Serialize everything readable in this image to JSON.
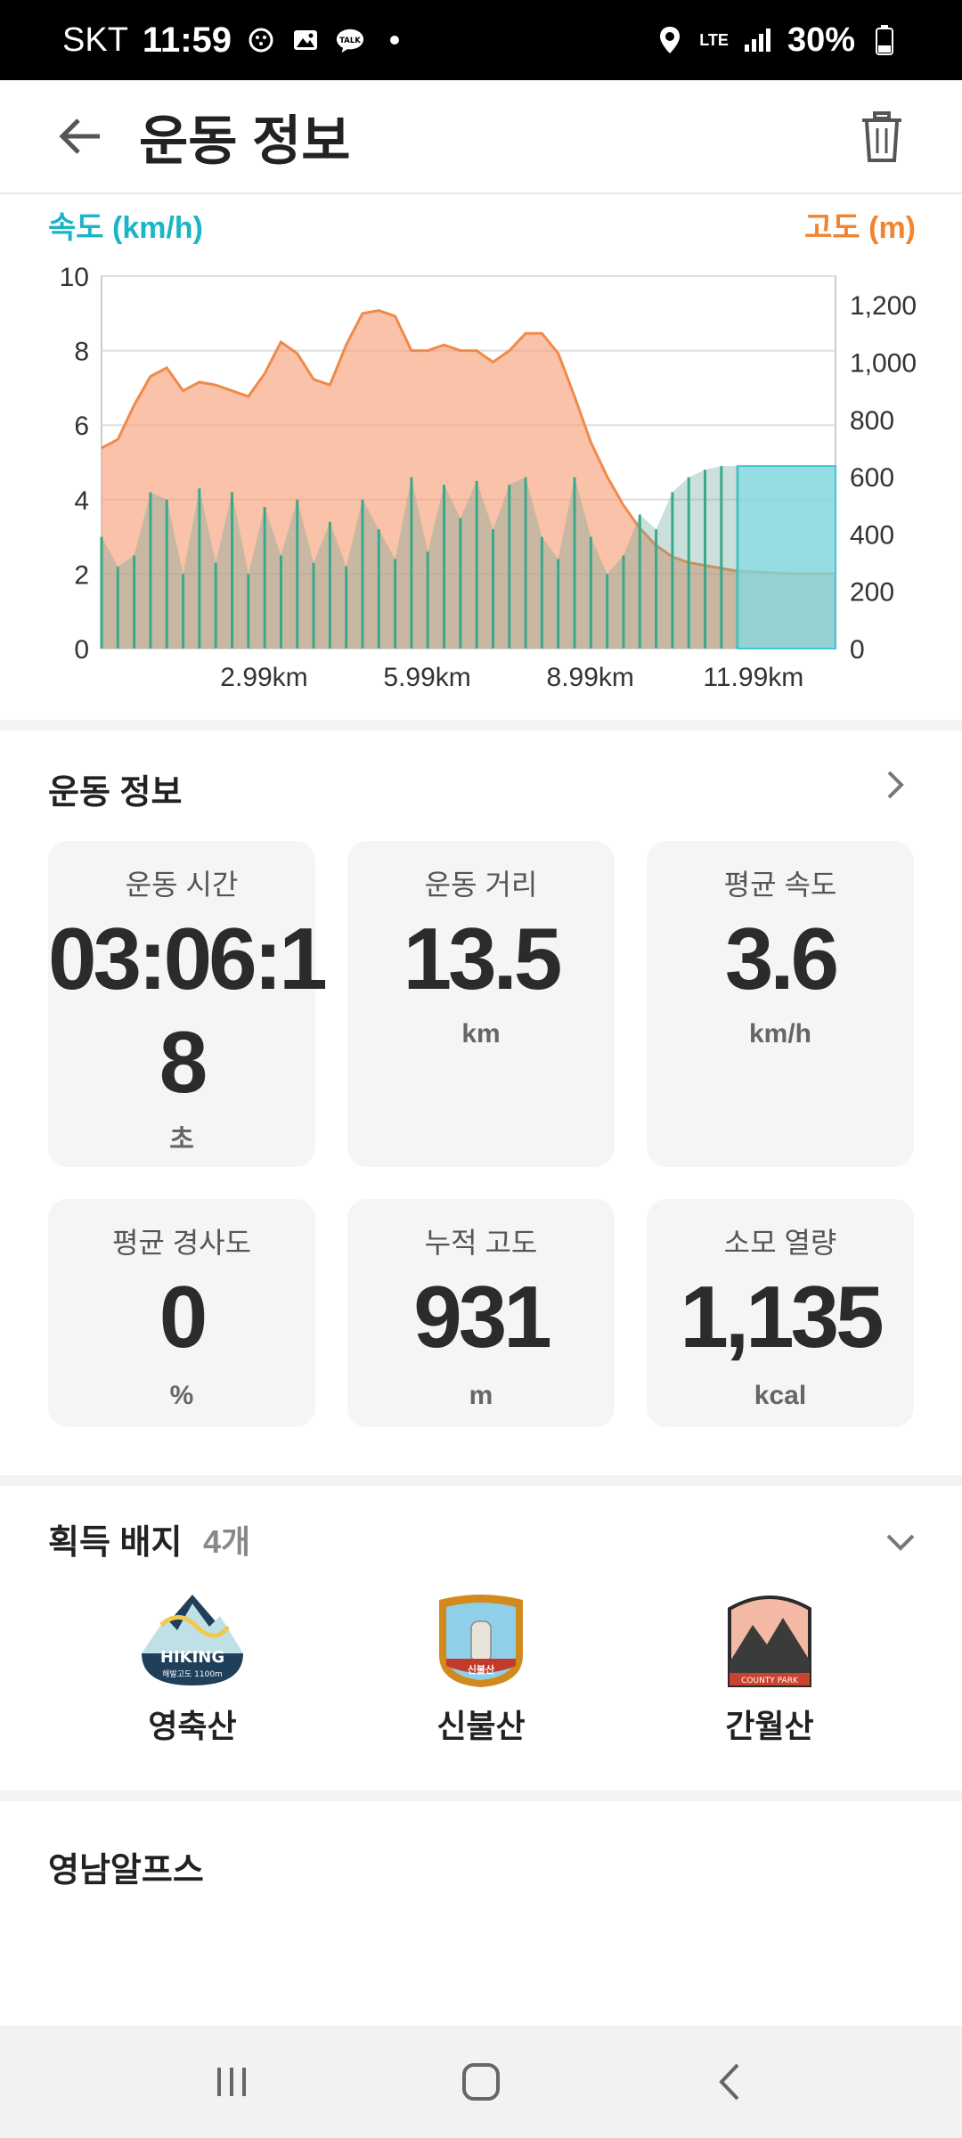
{
  "status": {
    "carrier": "SKT",
    "time": "11:59",
    "network": "LTE",
    "battery": "30%"
  },
  "header": {
    "title": "운동 정보"
  },
  "chart": {
    "left_axis_title": "속도 (km/h)",
    "right_axis_title": "고도 (m)"
  },
  "chart_data": {
    "type": "area",
    "xlabel": "",
    "x_ticks": [
      "2.99km",
      "5.99km",
      "8.99km",
      "11.99km"
    ],
    "left_ylabel": "속도 (km/h)",
    "left_ylim": [
      0,
      10
    ],
    "left_ticks": [
      "0",
      "2",
      "4",
      "6",
      "8",
      "10"
    ],
    "right_ylabel": "고도 (m)",
    "right_ylim": [
      0,
      1300
    ],
    "right_ticks": [
      "0",
      "200",
      "400",
      "600",
      "800",
      "1,000",
      "1,200"
    ],
    "grid": true,
    "series": [
      {
        "axis": "right",
        "color": "#f7a27a",
        "x": [
          0,
          0.3,
          0.6,
          0.9,
          1.2,
          1.5,
          1.8,
          2.1,
          2.4,
          2.7,
          3.0,
          3.3,
          3.6,
          3.9,
          4.2,
          4.5,
          4.8,
          5.1,
          5.4,
          5.7,
          6.0,
          6.3,
          6.6,
          6.9,
          7.2,
          7.5,
          7.8,
          8.1,
          8.4,
          8.7,
          9.0,
          9.3,
          9.6,
          9.9,
          10.2,
          10.5,
          10.8,
          11.1,
          11.4,
          11.7,
          12.0,
          12.3,
          12.6,
          12.9,
          13.2,
          13.5
        ],
        "y": [
          700,
          730,
          850,
          950,
          980,
          900,
          930,
          920,
          900,
          880,
          960,
          1070,
          1030,
          940,
          920,
          1060,
          1170,
          1180,
          1160,
          1040,
          1040,
          1060,
          1040,
          1040,
          1000,
          1040,
          1100,
          1100,
          1030,
          880,
          720,
          600,
          500,
          420,
          360,
          320,
          300,
          290,
          280,
          270,
          268,
          265,
          262,
          262,
          262,
          262
        ]
      },
      {
        "axis": "left",
        "color": "#3aa88a",
        "x": [
          0,
          0.3,
          0.6,
          0.9,
          1.2,
          1.5,
          1.8,
          2.1,
          2.4,
          2.7,
          3.0,
          3.3,
          3.6,
          3.9,
          4.2,
          4.5,
          4.8,
          5.1,
          5.4,
          5.7,
          6.0,
          6.3,
          6.6,
          6.9,
          7.2,
          7.5,
          7.8,
          8.1,
          8.4,
          8.7,
          9.0,
          9.3,
          9.6,
          9.9,
          10.2,
          10.5,
          10.8,
          11.1,
          11.4,
          11.7,
          12.0,
          12.3,
          12.6,
          12.9,
          13.2,
          13.5
        ],
        "y": [
          3.0,
          2.2,
          2.5,
          4.2,
          4.0,
          2.0,
          4.3,
          2.3,
          4.2,
          2.0,
          3.8,
          2.5,
          4.0,
          2.3,
          3.4,
          2.2,
          4.0,
          3.2,
          2.4,
          4.6,
          2.6,
          4.4,
          3.5,
          4.5,
          3.2,
          4.4,
          4.6,
          3.0,
          2.4,
          4.6,
          3.0,
          2.0,
          2.5,
          3.6,
          3.2,
          4.2,
          4.6,
          4.8,
          4.9,
          4.9,
          4.9,
          4.9,
          4.9,
          4.9,
          4.9,
          4.9
        ]
      }
    ]
  },
  "summary": {
    "section_title": "운동 정보",
    "cards": [
      {
        "label": "운동 시간",
        "value_line1": "03:06:1",
        "value_line2": "8",
        "unit": "초"
      },
      {
        "label": "운동 거리",
        "value": "13.5",
        "unit": "km"
      },
      {
        "label": "평균 속도",
        "value": "3.6",
        "unit": "km/h"
      },
      {
        "label": "평균 경사도",
        "value": "0",
        "unit": "%"
      },
      {
        "label": "누적 고도",
        "value": "931",
        "unit": "m"
      },
      {
        "label": "소모 열량",
        "value": "1,135",
        "unit": "kcal"
      }
    ]
  },
  "badges": {
    "title": "획득 배지",
    "count": "4개",
    "items": [
      {
        "name": "영축산",
        "art_text": "HIKING",
        "art_sub": "해발고도 1100m"
      },
      {
        "name": "신불산",
        "art_text": "신불산"
      },
      {
        "name": "간월산",
        "art_text": "COUNTY PARK"
      }
    ]
  },
  "footer": {
    "title": "영남알프스"
  }
}
